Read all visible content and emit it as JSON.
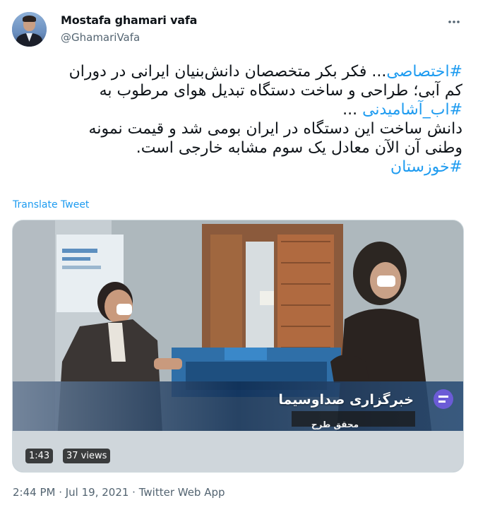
{
  "author": {
    "display_name": "Mostafa ghamari vafa",
    "handle": "@GhamariVafa"
  },
  "tweet": {
    "lines": [
      [
        "#اختصاصی",
        "... فکر بکر متخصصان دانش‌بنیان ایرانی در دوران"
      ],
      [
        "",
        "کم آبی؛ طراحی و ساخت دستگاه تبدیل هوای مرطوب به"
      ],
      [
        "#اب_آشامیدنی",
        " ..."
      ],
      [
        "",
        "دانش ساخت این دستگاه در ایران بومی شد و قیمت نمونه"
      ],
      [
        "",
        "وطنی آن الآن معادل یک سوم مشابه خارجی است."
      ],
      [
        "#خوزستان",
        ""
      ]
    ],
    "translate_label": "Translate Tweet"
  },
  "video": {
    "duration": "1:43",
    "views": "37 views",
    "overlay_title": "خبرگزاری صداوسیما",
    "overlay_subtitle": "محقق طرح"
  },
  "meta": {
    "timestamp": "2:44 PM · Jul 19, 2021 · Twitter Web App"
  },
  "colors": {
    "accent": "#1d9bf0",
    "text": "#0f1419",
    "secondary": "#536471"
  },
  "icons": {
    "more": "more-options-icon"
  }
}
